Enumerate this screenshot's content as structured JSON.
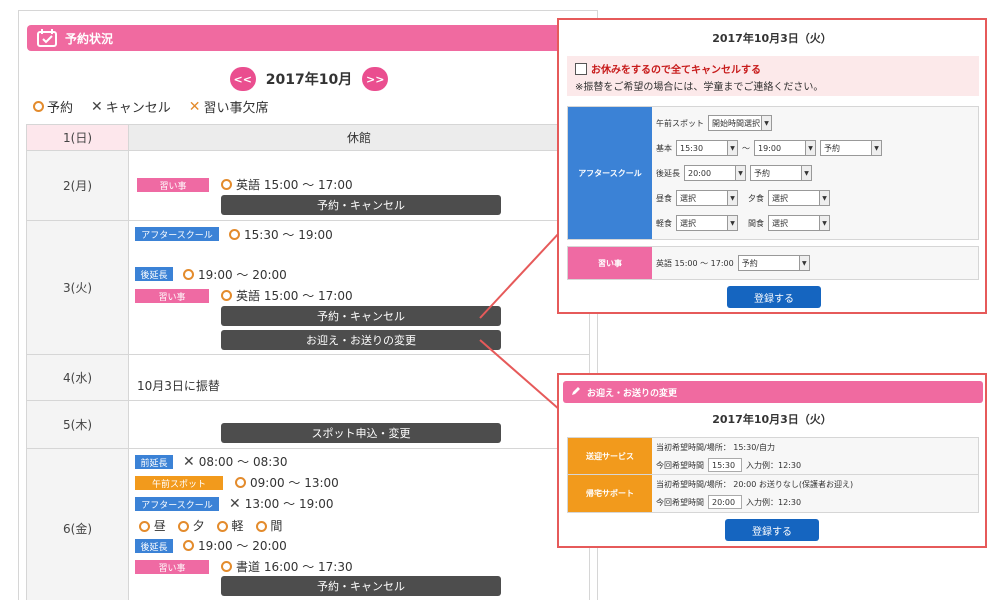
{
  "section_title": "予約状況",
  "month": {
    "prev": "<<",
    "title": "2017年10月",
    "next": ">>"
  },
  "legend": {
    "reserve": "予約",
    "cancel": "キャンセル",
    "absent": "習い事欠席"
  },
  "days": [
    {
      "label": "1(日)",
      "note": "休館"
    },
    {
      "label": "2(月)",
      "lesson_tag": "習い事",
      "lesson": "英語 15:00 〜 17:00",
      "btn": "予約・キャンセル"
    },
    {
      "label": "3(火)",
      "after_tag": "アフタースクール",
      "after": "15:30 〜 19:00",
      "ext_tag": "後延長",
      "ext": "19:00 〜 20:00",
      "lesson_tag": "習い事",
      "lesson": "英語 15:00 〜 17:00",
      "btn": "予約・キャンセル",
      "btn2": "お迎え・お送りの変更"
    },
    {
      "label": "4(水)",
      "note": "10月3日に振替"
    },
    {
      "label": "5(木)",
      "btn": "スポット申込・変更"
    },
    {
      "label": "6(金)",
      "pre_tag": "前延長",
      "pre": "08:00 〜 08:30",
      "spot_tag": "午前スポット",
      "spot": "09:00 〜 13:00",
      "after_tag": "アフタースクール",
      "after": "13:00 〜 19:00",
      "meals": [
        "昼",
        "夕",
        "軽",
        "間"
      ],
      "ext_tag": "後延長",
      "ext": "19:00 〜 20:00",
      "lesson_tag": "習い事",
      "lesson": "書道 16:00 〜 17:30",
      "btn": "予約・キャンセル"
    }
  ],
  "popup1": {
    "date": "2017年10月3日（火）",
    "cancel_all": "お休みをするので全てキャンセルする",
    "notice": "※振替をご希望の場合には、学童までご連絡ください。",
    "after_label": "アフタースクール",
    "spot_label": "午前スポット",
    "spot_select": "開始時間選択",
    "basic_label": "基本",
    "basic_from": "15:30",
    "tilde": "〜",
    "basic_to": "19:00",
    "basic_status": "予約",
    "ext_label": "後延長",
    "ext_time": "20:00",
    "ext_status": "予約",
    "lunch_label": "昼食",
    "lunch_select": "選択",
    "dinner_label": "夕食",
    "dinner_select": "選択",
    "light_label": "軽食",
    "light_select": "選択",
    "snack_label": "間食",
    "snack_select": "選択",
    "lesson_label": "習い事",
    "lesson_text": "英語 15:00 〜 17:00",
    "lesson_status": "予約",
    "submit": "登録する"
  },
  "popup2": {
    "bar_title": "お迎え・お送りの変更",
    "date": "2017年10月3日（火）",
    "pickup_label": "送迎サービス",
    "pickup_hope": "当初希望時間/場所： 15:30/自力",
    "pickup_this": "今回希望時間",
    "pickup_time": "15:30",
    "pickup_deadline": "入力例：12:30",
    "send_label": "帰宅サポート",
    "send_hope": "当初希望時間/場所： 20:00 お送りなし(保護者お迎え)",
    "send_this": "今回希望時間",
    "send_time": "20:00",
    "send_deadline": "入力例：12:30",
    "submit": "登録する"
  },
  "colors": {
    "pink": "#f06aa0",
    "blue": "#3b82d6",
    "orange": "#f29a1c",
    "red_border": "#e65a5a",
    "dark_btn": "#4d4d4d",
    "submit": "#1565c0"
  }
}
